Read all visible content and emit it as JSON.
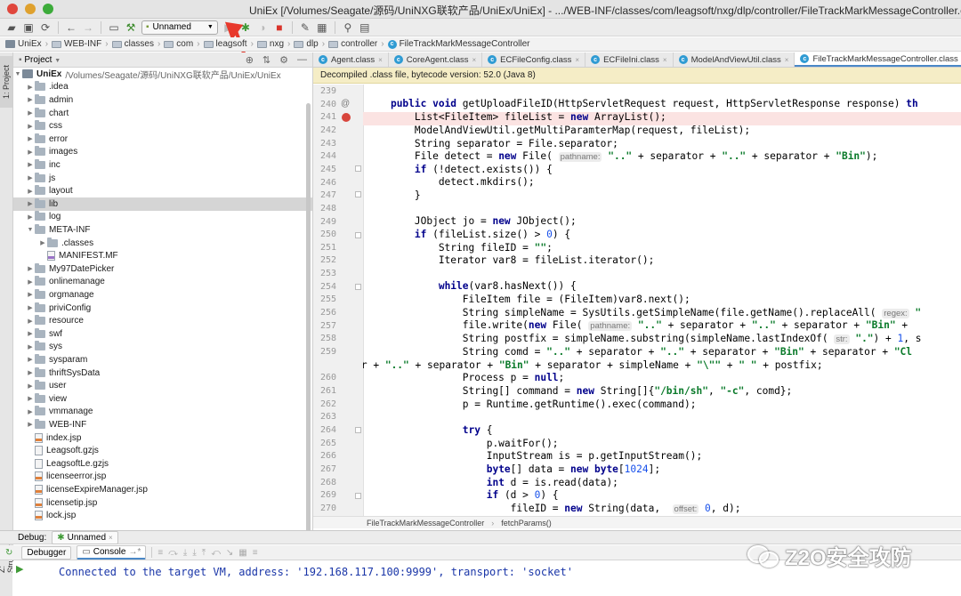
{
  "window": {
    "title": "UniEx [/Volumes/Seagate/源码/UniNXG联软产品/UniEx/UniEx] - .../WEB-INF/classes/com/leagsoft/nxg/dlp/controller/FileTrackMarkMessageController.class [UniEx]"
  },
  "toolbar": {
    "run_config": "Unnamed"
  },
  "navbar": {
    "crumbs": [
      "UniEx",
      "WEB-INF",
      "classes",
      "com",
      "leagsoft",
      "nxg",
      "dlp",
      "controller"
    ],
    "current_class": "FileTrackMarkMessageController"
  },
  "sidebar": {
    "project_tab": "1: Project",
    "structure_tab": "Z: Structure",
    "header_title": "Project"
  },
  "tree": {
    "root_name": "UniEx",
    "root_path": "/Volumes/Seagate/源码/UniNXG联软产品/UniEx/UniEx",
    "items": [
      {
        "label": ".idea",
        "type": "folder",
        "depth": 1
      },
      {
        "label": "admin",
        "type": "folder",
        "depth": 1
      },
      {
        "label": "chart",
        "type": "folder",
        "depth": 1
      },
      {
        "label": "css",
        "type": "folder",
        "depth": 1
      },
      {
        "label": "error",
        "type": "folder",
        "depth": 1
      },
      {
        "label": "images",
        "type": "folder",
        "depth": 1
      },
      {
        "label": "inc",
        "type": "folder",
        "depth": 1
      },
      {
        "label": "js",
        "type": "folder",
        "depth": 1
      },
      {
        "label": "layout",
        "type": "folder",
        "depth": 1
      },
      {
        "label": "lib",
        "type": "folder",
        "depth": 1
      },
      {
        "label": "log",
        "type": "folder",
        "depth": 1
      },
      {
        "label": "META-INF",
        "type": "folder-open",
        "depth": 1
      },
      {
        "label": ".classes",
        "type": "folder",
        "depth": 2
      },
      {
        "label": "MANIFEST.MF",
        "type": "mf",
        "depth": 2
      },
      {
        "label": "My97DatePicker",
        "type": "folder",
        "depth": 1
      },
      {
        "label": "onlinemanage",
        "type": "folder",
        "depth": 1
      },
      {
        "label": "orgmanage",
        "type": "folder",
        "depth": 1
      },
      {
        "label": "priviConfig",
        "type": "folder",
        "depth": 1
      },
      {
        "label": "resource",
        "type": "folder",
        "depth": 1
      },
      {
        "label": "swf",
        "type": "folder",
        "depth": 1
      },
      {
        "label": "sys",
        "type": "folder",
        "depth": 1
      },
      {
        "label": "sysparam",
        "type": "folder",
        "depth": 1
      },
      {
        "label": "thriftSysData",
        "type": "folder",
        "depth": 1
      },
      {
        "label": "user",
        "type": "folder",
        "depth": 1
      },
      {
        "label": "view",
        "type": "folder",
        "depth": 1
      },
      {
        "label": "vmmanage",
        "type": "folder",
        "depth": 1
      },
      {
        "label": "WEB-INF",
        "type": "folder",
        "depth": 1
      },
      {
        "label": "index.jsp",
        "type": "jsp",
        "depth": 1
      },
      {
        "label": "Leagsoft.gzjs",
        "type": "file",
        "depth": 1
      },
      {
        "label": "LeagsoftLe.gzjs",
        "type": "file",
        "depth": 1
      },
      {
        "label": "licenseerror.jsp",
        "type": "jsp",
        "depth": 1
      },
      {
        "label": "licenseExpireManager.jsp",
        "type": "jsp",
        "depth": 1
      },
      {
        "label": "licensetip.jsp",
        "type": "jsp",
        "depth": 1
      },
      {
        "label": "lock.jsp",
        "type": "jsp",
        "depth": 1
      }
    ]
  },
  "editor": {
    "tabs": [
      {
        "label": "Agent.class",
        "active": false
      },
      {
        "label": "CoreAgent.class",
        "active": false
      },
      {
        "label": "ECFileConfig.class",
        "active": false
      },
      {
        "label": "ECFileIni.class",
        "active": false
      },
      {
        "label": "ModelAndViewUtil.class",
        "active": false
      },
      {
        "label": "FileTrackMarkMessageController.class",
        "active": true
      }
    ],
    "banner": "Decompiled .class file, bytecode version: 52.0 (Java 8)",
    "line_numbers": [
      "239",
      "240",
      "241",
      "242",
      "243",
      "244",
      "245",
      "246",
      "247",
      "248",
      "249",
      "250",
      "251",
      "252",
      "253",
      "254",
      "255",
      "256",
      "257",
      "258",
      "259",
      "",
      "260",
      "261",
      "262",
      "263",
      "264",
      "265",
      "266",
      "267",
      "268",
      "269",
      "270"
    ],
    "breadcrumb_class": "FileTrackMarkMessageController",
    "breadcrumb_method": "fetchParams()"
  },
  "debug": {
    "label": "Debug:",
    "session": "Unnamed",
    "tab_debugger": "Debugger",
    "tab_console": "Console",
    "console_output": "Connected to the target VM, address: '192.168.117.100:9999', transport: 'socket'"
  },
  "watermark": {
    "text": "Z2O安全攻防"
  }
}
